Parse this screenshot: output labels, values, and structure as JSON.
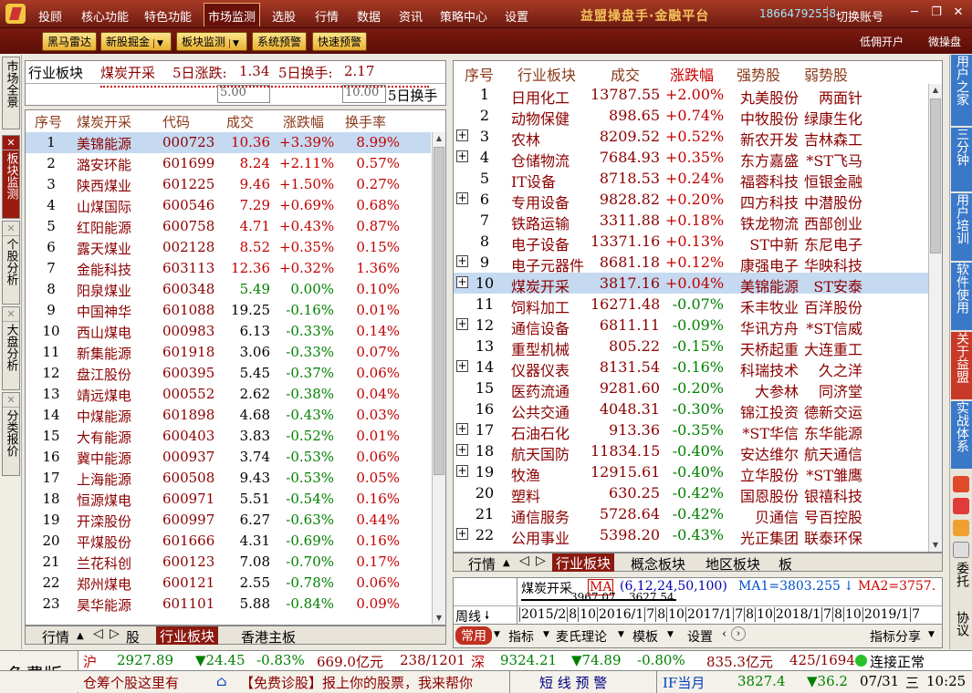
{
  "menu": {
    "items": [
      "投顾",
      "核心功能",
      "特色功能",
      "市场监测",
      "选股",
      "行情",
      "数据",
      "资讯",
      "策略中心",
      "设置"
    ],
    "brand": "益盟操盘手·金融平台",
    "phone": "18664792558",
    "switch_account": "切换账号"
  },
  "toolbar": {
    "buttons": [
      "黑马雷达",
      "新股掘金",
      "板块监测",
      "系统预警",
      "快速预警"
    ],
    "right": [
      "低佣开户",
      "微操盘"
    ]
  },
  "left_tabs": [
    "市场全景",
    "板块监测",
    "个股分析",
    "大盘分析",
    "分类报价"
  ],
  "right_tabs": [
    "用户之家",
    "三分钟",
    "用户培训",
    "软件使用",
    "关于益盟",
    "实战体系"
  ],
  "right_misc": [
    "委托",
    "协议"
  ],
  "info": {
    "label": "行业板块",
    "name": "煤炭开采",
    "change_label": "5日涨跌:",
    "change_val": "1.34",
    "turnover_label": "5日换手:",
    "turnover_val": "2.17",
    "scale_a": "5.00",
    "scale_b": "10.00",
    "scale_unit": "5日换手"
  },
  "stock_table": {
    "headers": [
      "序号",
      "煤炭开采",
      "代码",
      "成交",
      "涨跌幅",
      "换手率"
    ],
    "rows": [
      [
        "1",
        "美锦能源",
        "000723",
        "10.36",
        "+3.39%",
        "8.99%"
      ],
      [
        "2",
        "潞安环能",
        "601699",
        "8.24",
        "+2.11%",
        "0.57%"
      ],
      [
        "3",
        "陕西煤业",
        "601225",
        "9.46",
        "+1.50%",
        "0.27%"
      ],
      [
        "4",
        "山煤国际",
        "600546",
        "7.29",
        "+0.69%",
        "0.68%"
      ],
      [
        "5",
        "红阳能源",
        "600758",
        "4.71",
        "+0.43%",
        "0.87%"
      ],
      [
        "6",
        "露天煤业",
        "002128",
        "8.52",
        "+0.35%",
        "0.15%"
      ],
      [
        "7",
        "金能科技",
        "603113",
        "12.36",
        "+0.32%",
        "1.36%"
      ],
      [
        "8",
        "阳泉煤业",
        "600348",
        "5.49",
        "0.00%",
        "0.10%"
      ],
      [
        "9",
        "中国神华",
        "601088",
        "19.25",
        "-0.16%",
        "0.01%"
      ],
      [
        "10",
        "西山煤电",
        "000983",
        "6.13",
        "-0.33%",
        "0.14%"
      ],
      [
        "11",
        "新集能源",
        "601918",
        "3.06",
        "-0.33%",
        "0.07%"
      ],
      [
        "12",
        "盘江股份",
        "600395",
        "5.45",
        "-0.37%",
        "0.06%"
      ],
      [
        "13",
        "靖远煤电",
        "000552",
        "2.62",
        "-0.38%",
        "0.04%"
      ],
      [
        "14",
        "中煤能源",
        "601898",
        "4.68",
        "-0.43%",
        "0.03%"
      ],
      [
        "15",
        "大有能源",
        "600403",
        "3.83",
        "-0.52%",
        "0.01%"
      ],
      [
        "16",
        "冀中能源",
        "000937",
        "3.74",
        "-0.53%",
        "0.06%"
      ],
      [
        "17",
        "上海能源",
        "600508",
        "9.43",
        "-0.53%",
        "0.05%"
      ],
      [
        "18",
        "恒源煤电",
        "600971",
        "5.51",
        "-0.54%",
        "0.16%"
      ],
      [
        "19",
        "开滦股份",
        "600997",
        "6.27",
        "-0.63%",
        "0.44%"
      ],
      [
        "20",
        "平煤股份",
        "601666",
        "4.31",
        "-0.69%",
        "0.16%"
      ],
      [
        "21",
        "兰花科创",
        "600123",
        "7.08",
        "-0.70%",
        "0.17%"
      ],
      [
        "22",
        "郑州煤电",
        "600121",
        "2.55",
        "-0.78%",
        "0.06%"
      ],
      [
        "23",
        "昊华能源",
        "601101",
        "5.88",
        "-0.84%",
        "0.09%"
      ]
    ]
  },
  "left_bottom_tabs": [
    "行情",
    "股",
    "行业板块",
    "香港主板"
  ],
  "sector_table": {
    "headers": [
      "序号",
      "行业板块",
      "成交",
      "涨跌幅",
      "强势股",
      "弱势股"
    ],
    "rows": [
      [
        "1",
        "日用化工",
        "13787.55",
        "+2.00%",
        "丸美股份",
        "两面针"
      ],
      [
        "2",
        "动物保健",
        "898.65",
        "+0.74%",
        "中牧股份",
        "绿康生化"
      ],
      [
        "3",
        "农林",
        "8209.52",
        "+0.52%",
        "新农开发",
        "吉林森工"
      ],
      [
        "4",
        "仓储物流",
        "7684.93",
        "+0.35%",
        "东方嘉盛",
        "*ST飞马"
      ],
      [
        "5",
        "IT设备",
        "8718.53",
        "+0.24%",
        "福蓉科技",
        "恒银金融"
      ],
      [
        "6",
        "专用设备",
        "9828.82",
        "+0.20%",
        "四方科技",
        "中潜股份"
      ],
      [
        "7",
        "铁路运输",
        "3311.88",
        "+0.18%",
        "铁龙物流",
        "西部创业"
      ],
      [
        "8",
        "电子设备",
        "13371.16",
        "+0.13%",
        "ST中新",
        "东尼电子"
      ],
      [
        "9",
        "电子元器件",
        "8681.18",
        "+0.12%",
        "康强电子",
        "华映科技"
      ],
      [
        "10",
        "煤炭开采",
        "3817.16",
        "+0.04%",
        "美锦能源",
        "ST安泰"
      ],
      [
        "11",
        "饲料加工",
        "16271.48",
        "-0.07%",
        "禾丰牧业",
        "百洋股份"
      ],
      [
        "12",
        "通信设备",
        "6811.11",
        "-0.09%",
        "华讯方舟",
        "*ST信威"
      ],
      [
        "13",
        "重型机械",
        "805.22",
        "-0.15%",
        "天桥起重",
        "大连重工"
      ],
      [
        "14",
        "仪器仪表",
        "8131.54",
        "-0.16%",
        "科瑞技术",
        "久之洋"
      ],
      [
        "15",
        "医药流通",
        "9281.60",
        "-0.20%",
        "大参林",
        "同济堂"
      ],
      [
        "16",
        "公共交通",
        "4048.31",
        "-0.30%",
        "锦江投资",
        "德新交运"
      ],
      [
        "17",
        "石油石化",
        "913.36",
        "-0.35%",
        "*ST华信",
        "东华能源"
      ],
      [
        "18",
        "航天国防",
        "11834.15",
        "-0.40%",
        "安达维尔",
        "航天通信"
      ],
      [
        "19",
        "牧渔",
        "12915.61",
        "-0.40%",
        "立华股份",
        "*ST雏鹰"
      ],
      [
        "20",
        "塑料",
        "630.25",
        "-0.42%",
        "国恩股份",
        "银禧科技"
      ],
      [
        "21",
        "通信服务",
        "5728.64",
        "-0.42%",
        "贝通信",
        "号百控股"
      ],
      [
        "22",
        "公用事业",
        "5398.20",
        "-0.43%",
        "光正集团",
        "联泰环保"
      ]
    ]
  },
  "sector_plus_rows": [
    3,
    4,
    6,
    9,
    10,
    12,
    14,
    17,
    18,
    19,
    22
  ],
  "right_bottom_tabs": [
    "行情",
    "行业板块",
    "概念板块",
    "地区板块",
    "板"
  ],
  "chart": {
    "name": "煤炭开采",
    "ma_btn": "MA",
    "params": "(6,12,24,50,100)",
    "ma1": "MA1=3803.255",
    "ma2": "MA2=3757.",
    "price1": "3967.07",
    "price2": "3627.54",
    "period": "周线",
    "years": [
      "2015/2",
      "8",
      "10",
      "2016/1",
      "7",
      "8",
      "10",
      "2017/1",
      "7",
      "8",
      "10",
      "2018/1",
      "7",
      "8",
      "10",
      "2019/1",
      "7"
    ]
  },
  "chart_toolbar": {
    "items": [
      "常用",
      "指标",
      "麦氏理论",
      "模板",
      "设置",
      "指标分享"
    ]
  },
  "status": {
    "edition": "免费版",
    "sh_label": "沪",
    "sh_index": "2927.89",
    "sh_chg": "24.45",
    "sh_pct": "-0.83%",
    "sh_amt": "669.0亿元",
    "sh_cnt": "238/1201",
    "sz_label": "深",
    "sz_index": "9324.21",
    "sz_chg": "74.89",
    "sz_pct": "-0.80%",
    "sz_amt": "835.3亿元",
    "sz_cnt": "425/1694",
    "conn": "连接正常",
    "ticker": "仓筹个股这里有",
    "notice": "【免费诊股】报上你的股票，我来帮你",
    "alert": "短 线 预 警",
    "if_label": "IF当月",
    "if_val": "3827.4",
    "if_chg": "36.2",
    "date": "07/31",
    "weekday": "三",
    "time": "10:25"
  },
  "colors": {
    "menu_bg": "#8B2A1B",
    "up": "#C00000",
    "down": "#008000",
    "selected_row": "#C5D9F1"
  }
}
